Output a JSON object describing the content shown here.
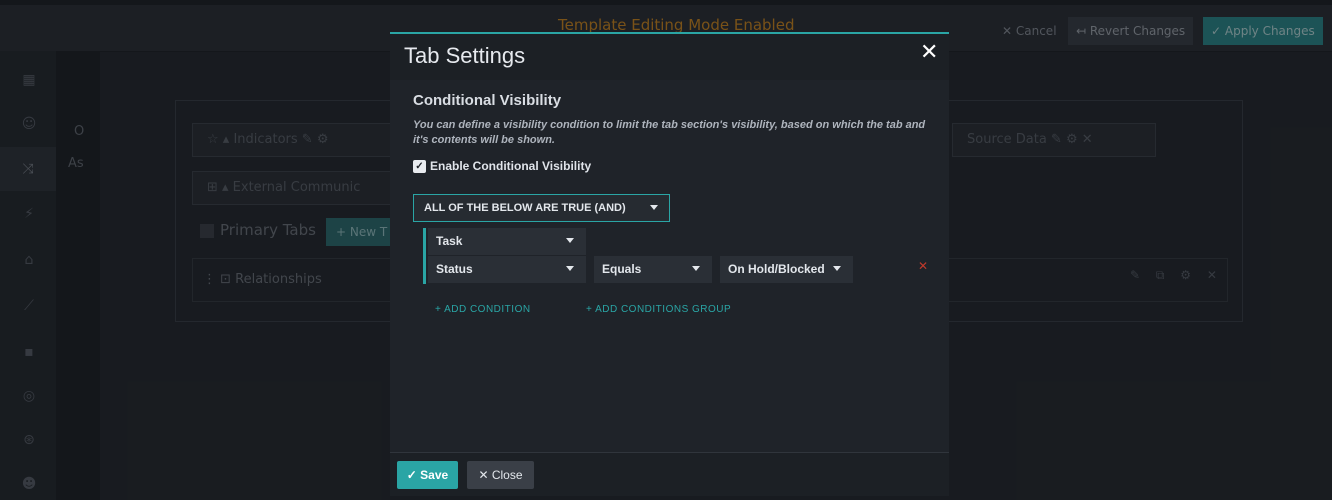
{
  "topbar": {
    "banner": "Template Editing Mode Enabled",
    "cancel_label": "✕ Cancel",
    "revert_label": "↤ Revert Changes",
    "apply_label": "✓ Apply Changes"
  },
  "subpanel": {
    "letter": "O",
    "abbrev": "As"
  },
  "editor": {
    "indicators": "☆ ▴  Indicators  ✎ ⚙",
    "external": "⊞ ▴  External Communic",
    "source_data": "Source Data  ✎ ⚙  ✕",
    "primary_tabs": "Primary Tabs",
    "new_tab": "+ New T",
    "relationships": "⋮   ⊡ Relationships",
    "row_icons": "✎ ⧉ ⚙ ✕"
  },
  "modal": {
    "title": "Tab Settings",
    "close_icon": "✕",
    "section_title": "Conditional Visibility",
    "description": "You can define a visibility condition to limit the tab section's visibility, based on which the tab and it's contents will be shown.",
    "enable_label": "Enable Conditional Visibility",
    "enable_checked": true,
    "logic_value": "ALL OF THE BELOW ARE TRUE (AND)",
    "condition": {
      "object": "Task",
      "field": "Status",
      "operator": "Equals",
      "value": "On Hold/Blocked"
    },
    "add_condition": "+ ADD CONDITION",
    "add_group": "+ ADD CONDITIONS GROUP",
    "save_label": "✓ Save",
    "close_label": "✕ Close"
  },
  "colors": {
    "accent": "#2aa5a5",
    "danger": "#c0392b",
    "banner": "#d48b1e"
  }
}
